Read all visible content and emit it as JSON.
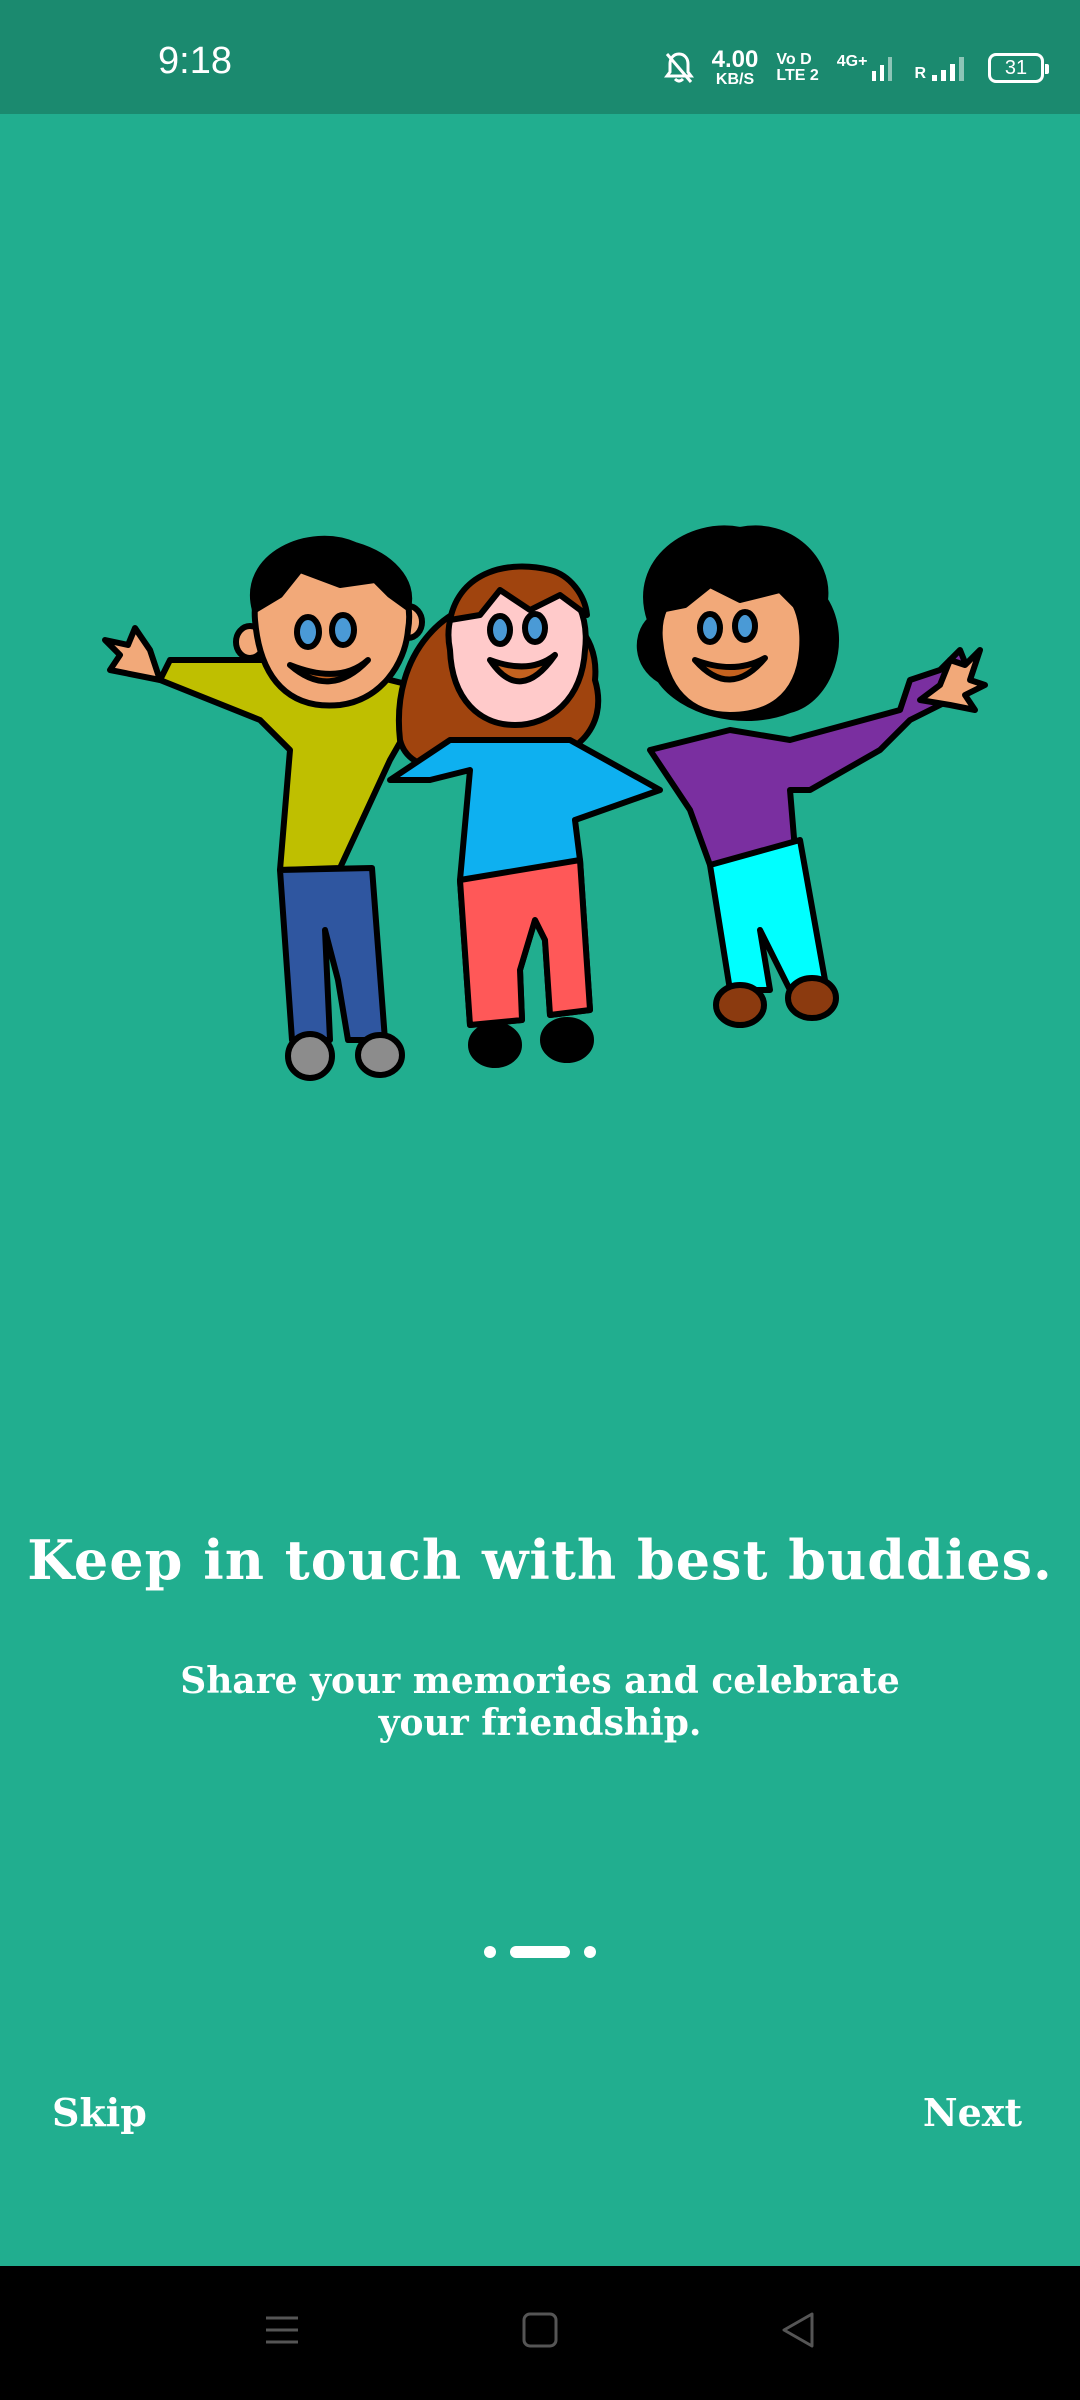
{
  "status_bar": {
    "time": "9:18",
    "net_speed_value": "4.00",
    "net_speed_unit": "KB/S",
    "vo_top": "Vo D",
    "vo_bottom": "LTE 2",
    "network": "4G+",
    "roaming": "R",
    "battery": "31"
  },
  "onboarding": {
    "illustration": "three-friends-illustration",
    "title": "Keep in touch with best buddies.",
    "subtitle": "Share your memories and celebrate your friendship.",
    "page_indicator": {
      "total": 3,
      "active": 2
    }
  },
  "actions": {
    "skip_label": "Skip",
    "next_label": "Next"
  },
  "nav_bar": {
    "icons": [
      "menu-icon",
      "home-icon",
      "back-icon"
    ]
  }
}
